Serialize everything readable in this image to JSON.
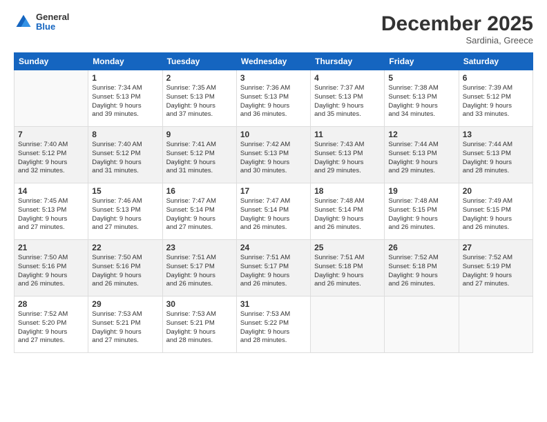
{
  "logo": {
    "general": "General",
    "blue": "Blue"
  },
  "header": {
    "month": "December 2025",
    "location": "Sardinia, Greece"
  },
  "columns": [
    "Sunday",
    "Monday",
    "Tuesday",
    "Wednesday",
    "Thursday",
    "Friday",
    "Saturday"
  ],
  "weeks": [
    [
      {
        "day": "",
        "info": ""
      },
      {
        "day": "1",
        "info": "Sunrise: 7:34 AM\nSunset: 5:13 PM\nDaylight: 9 hours\nand 39 minutes."
      },
      {
        "day": "2",
        "info": "Sunrise: 7:35 AM\nSunset: 5:13 PM\nDaylight: 9 hours\nand 37 minutes."
      },
      {
        "day": "3",
        "info": "Sunrise: 7:36 AM\nSunset: 5:13 PM\nDaylight: 9 hours\nand 36 minutes."
      },
      {
        "day": "4",
        "info": "Sunrise: 7:37 AM\nSunset: 5:13 PM\nDaylight: 9 hours\nand 35 minutes."
      },
      {
        "day": "5",
        "info": "Sunrise: 7:38 AM\nSunset: 5:13 PM\nDaylight: 9 hours\nand 34 minutes."
      },
      {
        "day": "6",
        "info": "Sunrise: 7:39 AM\nSunset: 5:12 PM\nDaylight: 9 hours\nand 33 minutes."
      }
    ],
    [
      {
        "day": "7",
        "info": "Sunrise: 7:40 AM\nSunset: 5:12 PM\nDaylight: 9 hours\nand 32 minutes."
      },
      {
        "day": "8",
        "info": "Sunrise: 7:40 AM\nSunset: 5:12 PM\nDaylight: 9 hours\nand 31 minutes."
      },
      {
        "day": "9",
        "info": "Sunrise: 7:41 AM\nSunset: 5:12 PM\nDaylight: 9 hours\nand 31 minutes."
      },
      {
        "day": "10",
        "info": "Sunrise: 7:42 AM\nSunset: 5:13 PM\nDaylight: 9 hours\nand 30 minutes."
      },
      {
        "day": "11",
        "info": "Sunrise: 7:43 AM\nSunset: 5:13 PM\nDaylight: 9 hours\nand 29 minutes."
      },
      {
        "day": "12",
        "info": "Sunrise: 7:44 AM\nSunset: 5:13 PM\nDaylight: 9 hours\nand 29 minutes."
      },
      {
        "day": "13",
        "info": "Sunrise: 7:44 AM\nSunset: 5:13 PM\nDaylight: 9 hours\nand 28 minutes."
      }
    ],
    [
      {
        "day": "14",
        "info": "Sunrise: 7:45 AM\nSunset: 5:13 PM\nDaylight: 9 hours\nand 27 minutes."
      },
      {
        "day": "15",
        "info": "Sunrise: 7:46 AM\nSunset: 5:13 PM\nDaylight: 9 hours\nand 27 minutes."
      },
      {
        "day": "16",
        "info": "Sunrise: 7:47 AM\nSunset: 5:14 PM\nDaylight: 9 hours\nand 27 minutes."
      },
      {
        "day": "17",
        "info": "Sunrise: 7:47 AM\nSunset: 5:14 PM\nDaylight: 9 hours\nand 26 minutes."
      },
      {
        "day": "18",
        "info": "Sunrise: 7:48 AM\nSunset: 5:14 PM\nDaylight: 9 hours\nand 26 minutes."
      },
      {
        "day": "19",
        "info": "Sunrise: 7:48 AM\nSunset: 5:15 PM\nDaylight: 9 hours\nand 26 minutes."
      },
      {
        "day": "20",
        "info": "Sunrise: 7:49 AM\nSunset: 5:15 PM\nDaylight: 9 hours\nand 26 minutes."
      }
    ],
    [
      {
        "day": "21",
        "info": "Sunrise: 7:50 AM\nSunset: 5:16 PM\nDaylight: 9 hours\nand 26 minutes."
      },
      {
        "day": "22",
        "info": "Sunrise: 7:50 AM\nSunset: 5:16 PM\nDaylight: 9 hours\nand 26 minutes."
      },
      {
        "day": "23",
        "info": "Sunrise: 7:51 AM\nSunset: 5:17 PM\nDaylight: 9 hours\nand 26 minutes."
      },
      {
        "day": "24",
        "info": "Sunrise: 7:51 AM\nSunset: 5:17 PM\nDaylight: 9 hours\nand 26 minutes."
      },
      {
        "day": "25",
        "info": "Sunrise: 7:51 AM\nSunset: 5:18 PM\nDaylight: 9 hours\nand 26 minutes."
      },
      {
        "day": "26",
        "info": "Sunrise: 7:52 AM\nSunset: 5:18 PM\nDaylight: 9 hours\nand 26 minutes."
      },
      {
        "day": "27",
        "info": "Sunrise: 7:52 AM\nSunset: 5:19 PM\nDaylight: 9 hours\nand 27 minutes."
      }
    ],
    [
      {
        "day": "28",
        "info": "Sunrise: 7:52 AM\nSunset: 5:20 PM\nDaylight: 9 hours\nand 27 minutes."
      },
      {
        "day": "29",
        "info": "Sunrise: 7:53 AM\nSunset: 5:21 PM\nDaylight: 9 hours\nand 27 minutes."
      },
      {
        "day": "30",
        "info": "Sunrise: 7:53 AM\nSunset: 5:21 PM\nDaylight: 9 hours\nand 28 minutes."
      },
      {
        "day": "31",
        "info": "Sunrise: 7:53 AM\nSunset: 5:22 PM\nDaylight: 9 hours\nand 28 minutes."
      },
      {
        "day": "",
        "info": ""
      },
      {
        "day": "",
        "info": ""
      },
      {
        "day": "",
        "info": ""
      }
    ]
  ]
}
